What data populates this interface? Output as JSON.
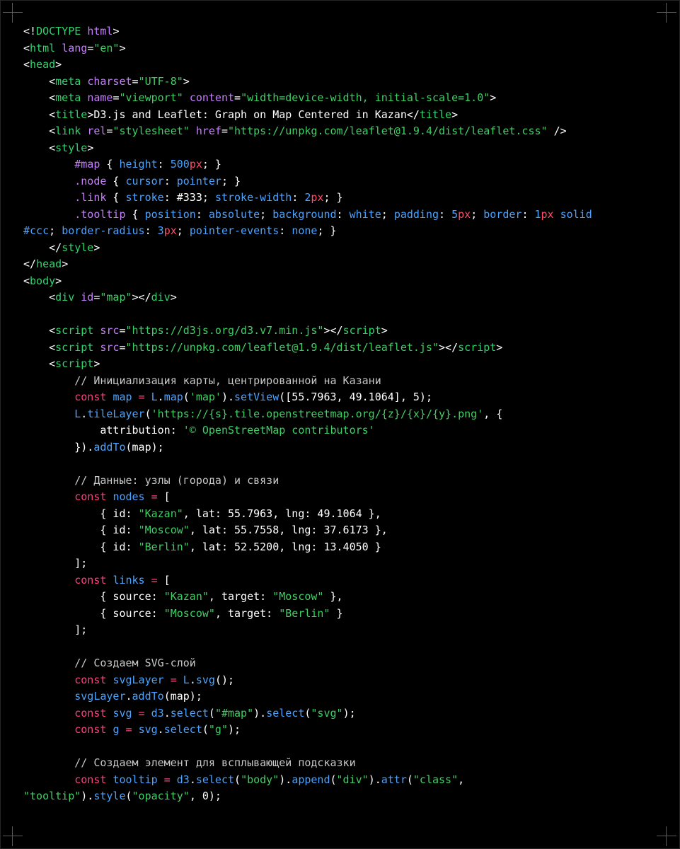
{
  "lines": [
    [
      [
        "pl",
        "<!"
      ],
      [
        "tag",
        "DOCTYPE"
      ],
      [
        "pl",
        " "
      ],
      [
        "attr",
        "html"
      ],
      [
        "pl",
        ">"
      ]
    ],
    [
      [
        "pl",
        "<"
      ],
      [
        "tag",
        "html"
      ],
      [
        "pl",
        " "
      ],
      [
        "attr",
        "lang"
      ],
      [
        "pl",
        "="
      ],
      [
        "str",
        "\"en\""
      ],
      [
        "pl",
        ">"
      ]
    ],
    [
      [
        "pl",
        "<"
      ],
      [
        "tag",
        "head"
      ],
      [
        "pl",
        ">"
      ]
    ],
    [
      [
        "pl",
        "    <"
      ],
      [
        "tag",
        "meta"
      ],
      [
        "pl",
        " "
      ],
      [
        "attr",
        "charset"
      ],
      [
        "pl",
        "="
      ],
      [
        "str",
        "\"UTF-8\""
      ],
      [
        "pl",
        ">"
      ]
    ],
    [
      [
        "pl",
        "    <"
      ],
      [
        "tag",
        "meta"
      ],
      [
        "pl",
        " "
      ],
      [
        "attr",
        "name"
      ],
      [
        "pl",
        "="
      ],
      [
        "str",
        "\"viewport\""
      ],
      [
        "pl",
        " "
      ],
      [
        "attr",
        "content"
      ],
      [
        "pl",
        "="
      ],
      [
        "str",
        "\"width=device-width, initial-scale=1.0\""
      ],
      [
        "pl",
        ">"
      ]
    ],
    [
      [
        "pl",
        "    <"
      ],
      [
        "tag",
        "title"
      ],
      [
        "pl",
        ">D3.js and Leaflet: Graph on Map Centered in Kazan</"
      ],
      [
        "tag",
        "title"
      ],
      [
        "pl",
        ">"
      ]
    ],
    [
      [
        "pl",
        "    <"
      ],
      [
        "tag",
        "link"
      ],
      [
        "pl",
        " "
      ],
      [
        "attr",
        "rel"
      ],
      [
        "pl",
        "="
      ],
      [
        "str",
        "\"stylesheet\""
      ],
      [
        "pl",
        " "
      ],
      [
        "attr",
        "href"
      ],
      [
        "pl",
        "="
      ],
      [
        "str",
        "\"https://unpkg.com/leaflet@1.9.4/dist/leaflet.css\""
      ],
      [
        "pl",
        " />"
      ]
    ],
    [
      [
        "pl",
        "    <"
      ],
      [
        "tag",
        "style"
      ],
      [
        "pl",
        ">"
      ]
    ],
    [
      [
        "pl",
        "        "
      ],
      [
        "attr",
        "#map"
      ],
      [
        "pl",
        " { "
      ],
      [
        "var",
        "height"
      ],
      [
        "pl",
        ": "
      ],
      [
        "var",
        "500"
      ],
      [
        "num",
        "px"
      ],
      [
        "pl",
        "; }"
      ]
    ],
    [
      [
        "pl",
        "        "
      ],
      [
        "attr",
        ".node"
      ],
      [
        "pl",
        " { "
      ],
      [
        "var",
        "cursor"
      ],
      [
        "pl",
        ": "
      ],
      [
        "var",
        "pointer"
      ],
      [
        "pl",
        "; }"
      ]
    ],
    [
      [
        "pl",
        "        "
      ],
      [
        "attr",
        ".link"
      ],
      [
        "pl",
        " { "
      ],
      [
        "var",
        "stroke"
      ],
      [
        "pl",
        ": #333; "
      ],
      [
        "var",
        "stroke-width"
      ],
      [
        "pl",
        ": "
      ],
      [
        "var",
        "2"
      ],
      [
        "num",
        "px"
      ],
      [
        "pl",
        "; }"
      ]
    ],
    [
      [
        "pl",
        "        "
      ],
      [
        "attr",
        ".tooltip"
      ],
      [
        "pl",
        " { "
      ],
      [
        "var",
        "position"
      ],
      [
        "pl",
        ": "
      ],
      [
        "var",
        "absolute"
      ],
      [
        "pl",
        "; "
      ],
      [
        "var",
        "background"
      ],
      [
        "pl",
        ": "
      ],
      [
        "var",
        "white"
      ],
      [
        "pl",
        "; "
      ],
      [
        "var",
        "padding"
      ],
      [
        "pl",
        ": "
      ],
      [
        "var",
        "5"
      ],
      [
        "num",
        "px"
      ],
      [
        "pl",
        "; "
      ],
      [
        "var",
        "border"
      ],
      [
        "pl",
        ": "
      ],
      [
        "var",
        "1"
      ],
      [
        "num",
        "px"
      ],
      [
        "pl",
        " "
      ],
      [
        "var",
        "solid"
      ]
    ],
    [
      [
        "var",
        "#ccc"
      ],
      [
        "pl",
        "; "
      ],
      [
        "var",
        "border-radius"
      ],
      [
        "pl",
        ": "
      ],
      [
        "var",
        "3"
      ],
      [
        "num",
        "px"
      ],
      [
        "pl",
        "; "
      ],
      [
        "var",
        "pointer-events"
      ],
      [
        "pl",
        ": "
      ],
      [
        "var",
        "none"
      ],
      [
        "pl",
        "; }"
      ]
    ],
    [
      [
        "pl",
        "    </"
      ],
      [
        "tag",
        "style"
      ],
      [
        "pl",
        ">"
      ]
    ],
    [
      [
        "pl",
        "</"
      ],
      [
        "tag",
        "head"
      ],
      [
        "pl",
        ">"
      ]
    ],
    [
      [
        "pl",
        "<"
      ],
      [
        "tag",
        "body"
      ],
      [
        "pl",
        ">"
      ]
    ],
    [
      [
        "pl",
        "    <"
      ],
      [
        "tag",
        "div"
      ],
      [
        "pl",
        " "
      ],
      [
        "attr",
        "id"
      ],
      [
        "pl",
        "="
      ],
      [
        "str",
        "\"map\""
      ],
      [
        "pl",
        "></"
      ],
      [
        "tag",
        "div"
      ],
      [
        "pl",
        ">"
      ]
    ],
    [],
    [
      [
        "pl",
        "    <"
      ],
      [
        "tag",
        "script"
      ],
      [
        "pl",
        " "
      ],
      [
        "attr",
        "src"
      ],
      [
        "pl",
        "="
      ],
      [
        "str",
        "\"https://d3js.org/d3.v7.min.js\""
      ],
      [
        "pl",
        "></"
      ],
      [
        "tag",
        "script"
      ],
      [
        "pl",
        ">"
      ]
    ],
    [
      [
        "pl",
        "    <"
      ],
      [
        "tag",
        "script"
      ],
      [
        "pl",
        " "
      ],
      [
        "attr",
        "src"
      ],
      [
        "pl",
        "="
      ],
      [
        "str",
        "\"https://unpkg.com/leaflet@1.9.4/dist/leaflet.js\""
      ],
      [
        "pl",
        "></"
      ],
      [
        "tag",
        "script"
      ],
      [
        "pl",
        ">"
      ]
    ],
    [
      [
        "pl",
        "    <"
      ],
      [
        "tag",
        "script"
      ],
      [
        "pl",
        ">"
      ]
    ],
    [
      [
        "cm",
        "        // Инициализация карты, центрированной на Казани"
      ]
    ],
    [
      [
        "pl",
        "        "
      ],
      [
        "kw",
        "const"
      ],
      [
        "pl",
        " "
      ],
      [
        "var",
        "map"
      ],
      [
        "pl",
        " "
      ],
      [
        "kw",
        "="
      ],
      [
        "pl",
        " "
      ],
      [
        "var",
        "L"
      ],
      [
        "pl",
        "."
      ],
      [
        "var",
        "map"
      ],
      [
        "pl",
        "("
      ],
      [
        "str",
        "'map'"
      ],
      [
        "pl",
        ")."
      ],
      [
        "var",
        "setView"
      ],
      [
        "pl",
        "([55.7963, 49.1064], 5);"
      ]
    ],
    [
      [
        "pl",
        "        "
      ],
      [
        "var",
        "L"
      ],
      [
        "pl",
        "."
      ],
      [
        "var",
        "tileLayer"
      ],
      [
        "pl",
        "("
      ],
      [
        "str",
        "'https://{s}.tile.openstreetmap.org/{z}/{x}/{y}.png'"
      ],
      [
        "pl",
        ", {"
      ]
    ],
    [
      [
        "pl",
        "            attribution: "
      ],
      [
        "str",
        "'© OpenStreetMap contributors'"
      ]
    ],
    [
      [
        "pl",
        "        })."
      ],
      [
        "var",
        "addTo"
      ],
      [
        "pl",
        "(map);"
      ]
    ],
    [],
    [
      [
        "cm",
        "        // Данные: узлы (города) и связи"
      ]
    ],
    [
      [
        "pl",
        "        "
      ],
      [
        "kw",
        "const"
      ],
      [
        "pl",
        " "
      ],
      [
        "var",
        "nodes"
      ],
      [
        "pl",
        " "
      ],
      [
        "kw",
        "="
      ],
      [
        "pl",
        " ["
      ]
    ],
    [
      [
        "pl",
        "            { id: "
      ],
      [
        "str",
        "\"Kazan\""
      ],
      [
        "pl",
        ", lat: 55.7963, lng: 49.1064 },"
      ]
    ],
    [
      [
        "pl",
        "            { id: "
      ],
      [
        "str",
        "\"Moscow\""
      ],
      [
        "pl",
        ", lat: 55.7558, lng: 37.6173 },"
      ]
    ],
    [
      [
        "pl",
        "            { id: "
      ],
      [
        "str",
        "\"Berlin\""
      ],
      [
        "pl",
        ", lat: 52.5200, lng: 13.4050 }"
      ]
    ],
    [
      [
        "pl",
        "        ];"
      ]
    ],
    [
      [
        "pl",
        "        "
      ],
      [
        "kw",
        "const"
      ],
      [
        "pl",
        " "
      ],
      [
        "var",
        "links"
      ],
      [
        "pl",
        " "
      ],
      [
        "kw",
        "="
      ],
      [
        "pl",
        " ["
      ]
    ],
    [
      [
        "pl",
        "            { source: "
      ],
      [
        "str",
        "\"Kazan\""
      ],
      [
        "pl",
        ", target: "
      ],
      [
        "str",
        "\"Moscow\""
      ],
      [
        "pl",
        " },"
      ]
    ],
    [
      [
        "pl",
        "            { source: "
      ],
      [
        "str",
        "\"Moscow\""
      ],
      [
        "pl",
        ", target: "
      ],
      [
        "str",
        "\"Berlin\""
      ],
      [
        "pl",
        " }"
      ]
    ],
    [
      [
        "pl",
        "        ];"
      ]
    ],
    [],
    [
      [
        "cm",
        "        // Создаем SVG-слой"
      ]
    ],
    [
      [
        "pl",
        "        "
      ],
      [
        "kw",
        "const"
      ],
      [
        "pl",
        " "
      ],
      [
        "var",
        "svgLayer"
      ],
      [
        "pl",
        " "
      ],
      [
        "kw",
        "="
      ],
      [
        "pl",
        " "
      ],
      [
        "var",
        "L"
      ],
      [
        "pl",
        "."
      ],
      [
        "var",
        "svg"
      ],
      [
        "pl",
        "();"
      ]
    ],
    [
      [
        "pl",
        "        "
      ],
      [
        "var",
        "svgLayer"
      ],
      [
        "pl",
        "."
      ],
      [
        "var",
        "addTo"
      ],
      [
        "pl",
        "(map);"
      ]
    ],
    [
      [
        "pl",
        "        "
      ],
      [
        "kw",
        "const"
      ],
      [
        "pl",
        " "
      ],
      [
        "var",
        "svg"
      ],
      [
        "pl",
        " "
      ],
      [
        "kw",
        "="
      ],
      [
        "pl",
        " "
      ],
      [
        "var",
        "d3"
      ],
      [
        "pl",
        "."
      ],
      [
        "var",
        "select"
      ],
      [
        "pl",
        "("
      ],
      [
        "str",
        "\"#map\""
      ],
      [
        "pl",
        ")."
      ],
      [
        "var",
        "select"
      ],
      [
        "pl",
        "("
      ],
      [
        "str",
        "\"svg\""
      ],
      [
        "pl",
        ");"
      ]
    ],
    [
      [
        "pl",
        "        "
      ],
      [
        "kw",
        "const"
      ],
      [
        "pl",
        " "
      ],
      [
        "var",
        "g"
      ],
      [
        "pl",
        " "
      ],
      [
        "kw",
        "="
      ],
      [
        "pl",
        " "
      ],
      [
        "var",
        "svg"
      ],
      [
        "pl",
        "."
      ],
      [
        "var",
        "select"
      ],
      [
        "pl",
        "("
      ],
      [
        "str",
        "\"g\""
      ],
      [
        "pl",
        ");"
      ]
    ],
    [],
    [
      [
        "cm",
        "        // Создаем элемент для всплывающей подсказки"
      ]
    ],
    [
      [
        "pl",
        "        "
      ],
      [
        "kw",
        "const"
      ],
      [
        "pl",
        " "
      ],
      [
        "var",
        "tooltip"
      ],
      [
        "pl",
        " "
      ],
      [
        "kw",
        "="
      ],
      [
        "pl",
        " "
      ],
      [
        "var",
        "d3"
      ],
      [
        "pl",
        "."
      ],
      [
        "var",
        "select"
      ],
      [
        "pl",
        "("
      ],
      [
        "str",
        "\"body\""
      ],
      [
        "pl",
        ")."
      ],
      [
        "var",
        "append"
      ],
      [
        "pl",
        "("
      ],
      [
        "str",
        "\"div\""
      ],
      [
        "pl",
        ")."
      ],
      [
        "var",
        "attr"
      ],
      [
        "pl",
        "("
      ],
      [
        "str",
        "\"class\""
      ],
      [
        "pl",
        ","
      ]
    ],
    [
      [
        "str",
        "\"tooltip\""
      ],
      [
        "pl",
        ")."
      ],
      [
        "var",
        "style"
      ],
      [
        "pl",
        "("
      ],
      [
        "str",
        "\"opacity\""
      ],
      [
        "pl",
        ", 0);"
      ]
    ]
  ]
}
